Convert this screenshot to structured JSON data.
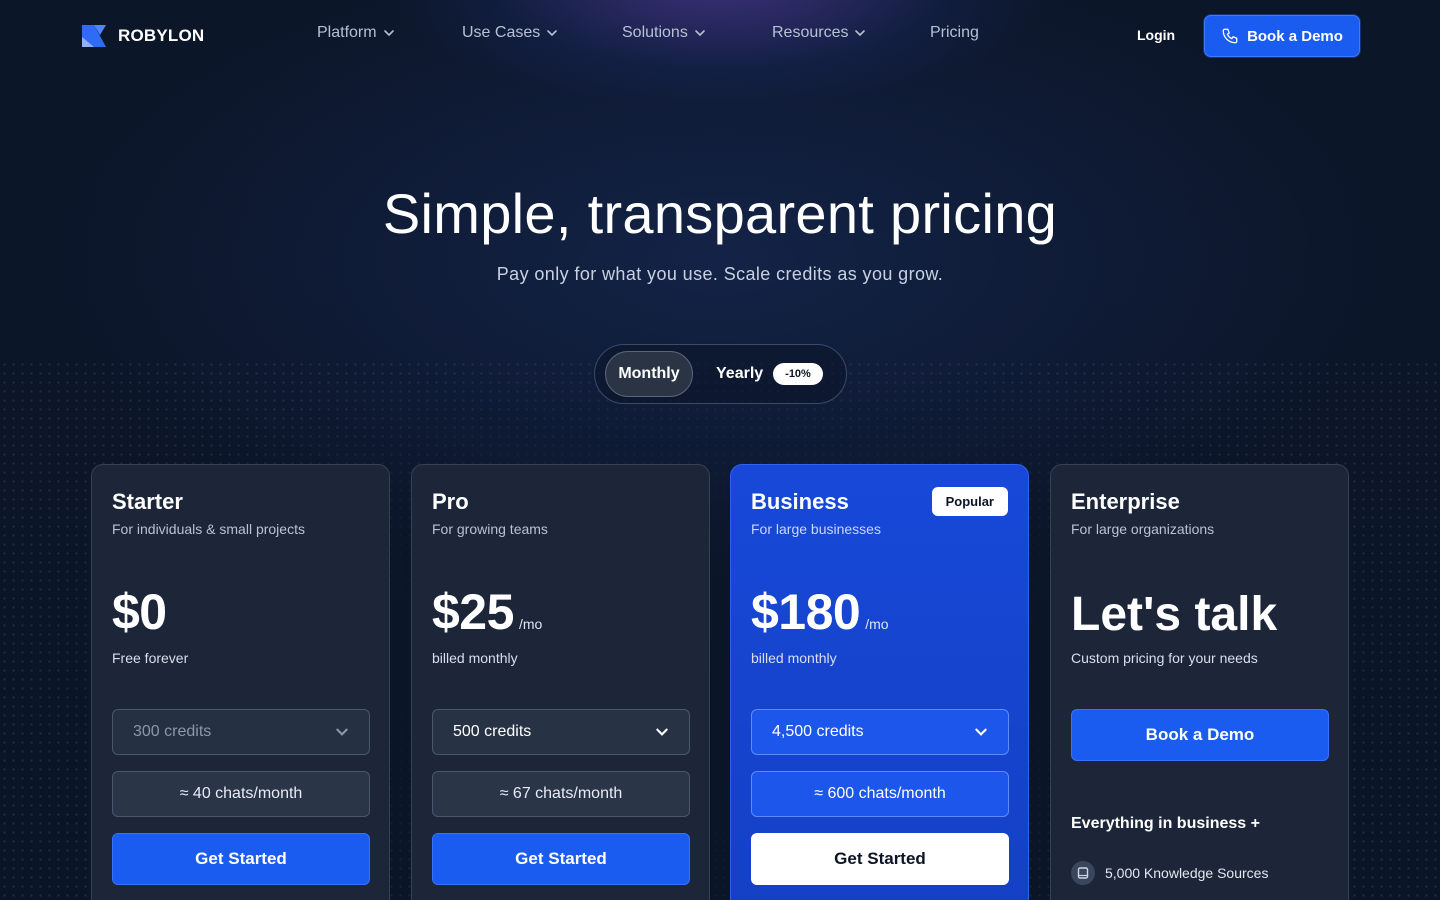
{
  "brand": {
    "name": "ROBYLON"
  },
  "nav": {
    "items": [
      {
        "label": "Platform",
        "dropdown": true
      },
      {
        "label": "Use Cases",
        "dropdown": true
      },
      {
        "label": "Solutions",
        "dropdown": true
      },
      {
        "label": "Resources",
        "dropdown": true
      },
      {
        "label": "Pricing",
        "dropdown": false
      }
    ],
    "login_label": "Login",
    "demo_label": "Book a Demo"
  },
  "hero": {
    "title": "Simple, transparent pricing",
    "subtitle": "Pay only for what you use. Scale credits as you grow."
  },
  "billing_toggle": {
    "monthly_label": "Monthly",
    "yearly_label": "Yearly",
    "yearly_badge": "-10%",
    "selected": "Monthly"
  },
  "plans": [
    {
      "name": "Starter",
      "description": "For individuals & small projects",
      "price": "$0",
      "price_unit": "",
      "price_note": "Free forever",
      "credits": "300 credits",
      "chats": "≈ 40 chats/month",
      "cta": "Get Started"
    },
    {
      "name": "Pro",
      "description": "For growing teams",
      "price": "$25",
      "price_unit": "/mo",
      "price_note": "billed monthly",
      "credits": "500 credits",
      "chats": "≈ 67 chats/month",
      "cta": "Get Started"
    },
    {
      "name": "Business",
      "description": "For large businesses",
      "badge": "Popular",
      "price": "$180",
      "price_unit": "/mo",
      "price_note": "billed monthly",
      "credits": "4,500 credits",
      "chats": "≈ 600 chats/month",
      "cta": "Get Started"
    },
    {
      "name": "Enterprise",
      "description": "For large organizations",
      "price": "Let's talk",
      "price_note": "Custom pricing for your needs",
      "cta": "Book a Demo",
      "features_heading": "Everything in business +",
      "features": [
        "5,000 Knowledge Sources"
      ]
    }
  ],
  "colors": {
    "background": "#0b1426",
    "accent": "#1b5cf0",
    "card": "#1c2638",
    "business_card": "#1748d8"
  }
}
